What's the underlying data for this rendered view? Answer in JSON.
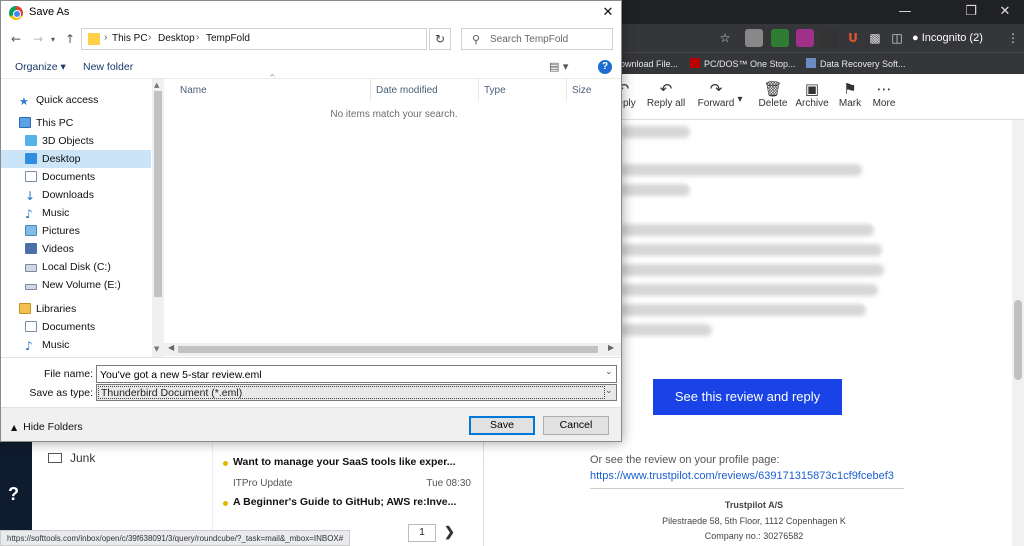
{
  "browser": {
    "incognito_label": "Incognito (2)",
    "bookmarks": [
      "ownload File...",
      "PC/DOS™ One Stop...",
      "Data Recovery Soft..."
    ]
  },
  "mail_toolbar": {
    "reply": "Reply",
    "reply_all": "Reply all",
    "forward": "Forward",
    "delete": "Delete",
    "archive": "Archive",
    "mark": "Mark",
    "more": "More"
  },
  "email": {
    "cta": "See this review and reply",
    "or_see": "Or see the review on your profile page:",
    "review_link": "https://www.trustpilot.com/reviews/639171315873c1cf9fcebef3",
    "company_name": "Trustpilot A/S",
    "company_address": "Pilestraede 58, 5th Floor, 1112 Copenhagen K",
    "company_no": "Company no.: 30276582"
  },
  "mail_list": {
    "folder_junk": "Junk",
    "msgs": [
      {
        "sender": "ITPro Update",
        "time": "Tue 08:30",
        "subject": "A Beginner's Guide to GitHub; AWS re:Inve..."
      },
      {
        "subject": "Want to manage your SaaS tools like exper..."
      }
    ],
    "page": "1"
  },
  "status_url": "https://softtools.com/inbox/open/c/39f638091/3/query/roundcube/?_task=mail&_mbox=INBOX#",
  "dialog": {
    "title": "Save As",
    "breadcrumbs": [
      "This PC",
      "Desktop",
      "TempFold"
    ],
    "search_placeholder": "Search TempFold",
    "organize": "Organize ▾",
    "new_folder": "New folder",
    "nav": {
      "quick_access": "Quick access",
      "this_pc": "This PC",
      "objects3d": "3D Objects",
      "desktop": "Desktop",
      "documents": "Documents",
      "downloads": "Downloads",
      "music": "Music",
      "pictures": "Pictures",
      "videos": "Videos",
      "local_disk": "Local Disk (C:)",
      "new_volume": "New Volume (E:)",
      "libraries": "Libraries",
      "lib_documents": "Documents",
      "lib_music": "Music"
    },
    "columns": {
      "name": "Name",
      "date": "Date modified",
      "type": "Type",
      "size": "Size"
    },
    "empty_msg": "No items match your search.",
    "file_name_label": "File name:",
    "file_name_value": "You've got a new 5-star review.eml",
    "save_type_label": "Save as type:",
    "save_type_value": "Thunderbird Document (*.eml)",
    "hide_folders": "Hide Folders",
    "save": "Save",
    "cancel": "Cancel"
  }
}
